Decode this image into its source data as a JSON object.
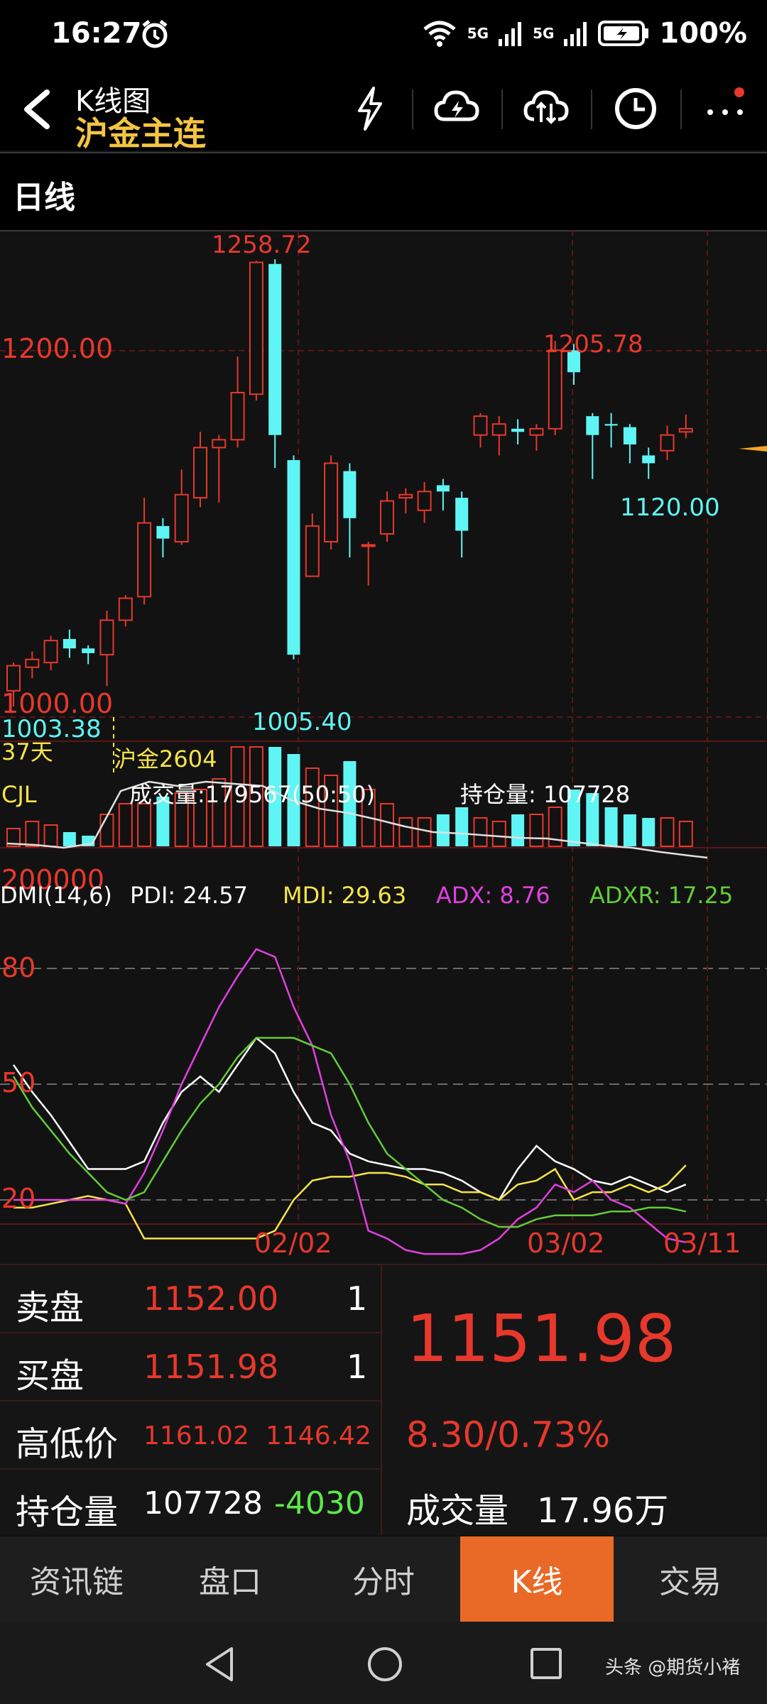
{
  "status": {
    "time": "16:27",
    "battery": "100%",
    "net1": "5G",
    "net2": "5G"
  },
  "header": {
    "title": "K线图",
    "subtitle": "沪金主连"
  },
  "period": "日线",
  "chart": {
    "price_labels": {
      "p1200": "1200.00",
      "p1000": "1000.00"
    },
    "annotations": {
      "high": "1258.72",
      "high2": "1205.78",
      "low_right": "1120.00",
      "low_left": "1003.38",
      "low_mid": "1005.40",
      "days": "37天",
      "contract": "沪金2604"
    },
    "volume": {
      "name": "CJL",
      "volume_text": "成交量:179567(50:50)",
      "oi_text": "持仓量: 107728",
      "axis": "200000"
    },
    "dmi": {
      "name": "DMI(14,6)",
      "pdi": "PDI: 24.57",
      "mdi": "MDI: 29.63",
      "adx": "ADX: 8.76",
      "adxr": "ADXR: 17.25",
      "l80": "80",
      "l50": "50",
      "l20": "20"
    },
    "dates": {
      "d1": "02/02",
      "d2": "03/02",
      "d3": "03/11"
    }
  },
  "chart_data": {
    "type": "candlestick",
    "candles": [
      [
        985,
        1001,
        975,
        1003
      ],
      [
        1000,
        1005,
        993,
        1010
      ],
      [
        1003,
        1017,
        998,
        1020
      ],
      [
        1018,
        1012,
        1006,
        1024
      ],
      [
        1012,
        1009,
        1002,
        1014
      ],
      [
        1008,
        1030,
        988,
        1036
      ],
      [
        1030,
        1044,
        1026,
        1046
      ],
      [
        1045,
        1092,
        1040,
        1108
      ],
      [
        1090,
        1082,
        1070,
        1095
      ],
      [
        1080,
        1110,
        1078,
        1126
      ],
      [
        1108,
        1140,
        1102,
        1150
      ],
      [
        1140,
        1145,
        1105,
        1148
      ],
      [
        1145,
        1175,
        1140,
        1198
      ],
      [
        1174,
        1258,
        1170,
        1259
      ],
      [
        1257,
        1148,
        1127,
        1260
      ],
      [
        1132,
        1008,
        1005,
        1135
      ],
      [
        1058,
        1090,
        1060,
        1098
      ],
      [
        1080,
        1130,
        1075,
        1135
      ],
      [
        1125,
        1095,
        1070,
        1130
      ],
      [
        1078,
        1078,
        1052,
        1080
      ],
      [
        1085,
        1106,
        1080,
        1112
      ],
      [
        1108,
        1110,
        1098,
        1114
      ],
      [
        1100,
        1112,
        1092,
        1118
      ],
      [
        1116,
        1112,
        1100,
        1120
      ],
      [
        1108,
        1087,
        1070,
        1112
      ],
      [
        1148,
        1160,
        1140,
        1162
      ],
      [
        1148,
        1155,
        1135,
        1160
      ],
      [
        1152,
        1150,
        1142,
        1158
      ],
      [
        1148,
        1152,
        1138,
        1155
      ],
      [
        1152,
        1202,
        1148,
        1208
      ],
      [
        1202,
        1188,
        1180,
        1206
      ],
      [
        1160,
        1148,
        1120,
        1162
      ],
      [
        1155,
        1154,
        1140,
        1162
      ],
      [
        1153,
        1142,
        1130,
        1155
      ],
      [
        1135,
        1130,
        1120,
        1140
      ],
      [
        1138,
        1148,
        1132,
        1154
      ],
      [
        1150,
        1152,
        1146,
        1161
      ]
    ],
    "volume": [
      25,
      35,
      30,
      20,
      15,
      45,
      60,
      60,
      70,
      75,
      80,
      95,
      140,
      140,
      140,
      130,
      110,
      100,
      120,
      80,
      60,
      40,
      40,
      45,
      55,
      40,
      35,
      45,
      45,
      55,
      80,
      75,
      55,
      45,
      40,
      40,
      35
    ],
    "y_price": [
      980,
      1275
    ],
    "series": [
      {
        "name": "PDI",
        "values": [
          55,
          48,
          42,
          35,
          28,
          28,
          28,
          30,
          40,
          48,
          52,
          48,
          55,
          62,
          58,
          48,
          40,
          38,
          32,
          30,
          29,
          28,
          28,
          27,
          25,
          22,
          20,
          28,
          34,
          30,
          28,
          25,
          24,
          26,
          24,
          22,
          24
        ]
      },
      {
        "name": "MDI",
        "values": [
          18,
          18,
          19,
          20,
          21,
          20,
          19,
          10,
          10,
          10,
          10,
          10,
          10,
          10,
          12,
          20,
          25,
          26,
          26,
          27,
          27,
          26,
          24,
          24,
          22,
          22,
          20,
          24,
          25,
          28,
          20,
          22,
          22,
          24,
          22,
          24,
          29
        ]
      },
      {
        "name": "ADX",
        "values": [
          20,
          20,
          20,
          20,
          20,
          20,
          19,
          27,
          38,
          50,
          60,
          70,
          78,
          85,
          83,
          70,
          60,
          42,
          30,
          12,
          10,
          7,
          6,
          6,
          6,
          7,
          10,
          15,
          18,
          24,
          22,
          25,
          20,
          18,
          14,
          10,
          9
        ]
      },
      {
        "name": "ADXR",
        "values": [
          52,
          44,
          38,
          32,
          27,
          22,
          20,
          22,
          30,
          38,
          45,
          50,
          57,
          62,
          62,
          62,
          60,
          58,
          50,
          40,
          32,
          28,
          24,
          20,
          18,
          15,
          13,
          13,
          15,
          16,
          16,
          16,
          17,
          17,
          18,
          18,
          17
        ]
      }
    ]
  },
  "quote": {
    "sell_label": "卖盘",
    "sell_price": "1152.00",
    "sell_qty": "1",
    "buy_label": "买盘",
    "buy_price": "1151.98",
    "buy_qty": "1",
    "hl_label": "高低价",
    "high": "1161.02",
    "low": "1146.42",
    "oi_label": "持仓量",
    "oi": "107728",
    "oi_change": "-4030",
    "last": "1151.98",
    "change": "8.30/0.73%",
    "vol_label": "成交量",
    "vol": "17.96万"
  },
  "tabs": [
    "资讯链",
    "盘口",
    "分时",
    "K线",
    "交易"
  ],
  "watermark": "头条 @期货小褚"
}
